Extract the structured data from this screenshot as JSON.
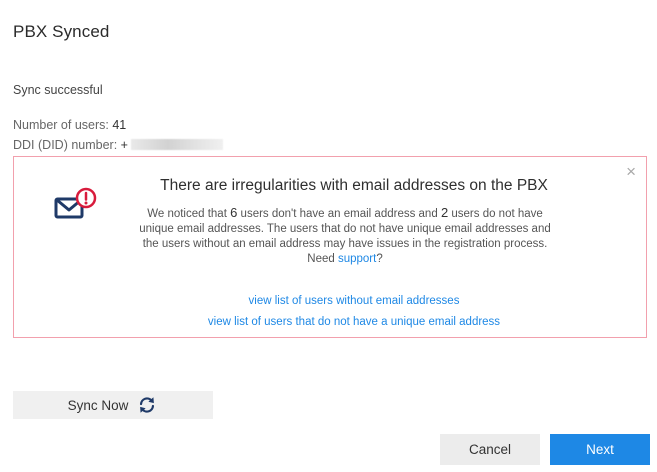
{
  "page": {
    "title": "PBX Synced"
  },
  "sync": {
    "status": "Sync successful",
    "users_label": "Number of users:",
    "users_value": "41",
    "ddi_label": "DDI (DID) number:",
    "ddi_value_prefix": "+"
  },
  "alert": {
    "close_glyph": "×",
    "title": "There are irregularities with email addresses on the PBX",
    "text_1": "We noticed that",
    "users_without_email_count": "6",
    "text_2": "users don't have an email address and",
    "users_not_unique_count": "2",
    "text_3": "users do not have unique email addresses. The users that do not have unique email addresses and the users without an email address may have issues in the registration process.",
    "need_label": "Need",
    "support_link": "support",
    "question_mark": "?",
    "link_without_email": "view list of users without email addresses",
    "link_not_unique": "view list of users that do not have a unique email address",
    "icon": "mail-alert-icon"
  },
  "actions": {
    "sync_now_label": "Sync Now",
    "sync_icon": "sync-icon",
    "cancel_label": "Cancel",
    "next_label": "Next"
  },
  "colors": {
    "accent": "#1e88e5",
    "alert_border": "#f2a0ad",
    "alert_red": "#d81b3c",
    "icon_navy": "#1f3a68"
  }
}
